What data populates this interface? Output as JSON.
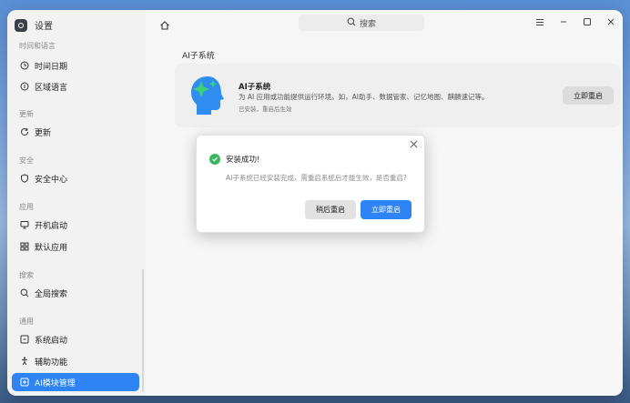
{
  "app": {
    "title": "设置"
  },
  "sidebar": {
    "groups": [
      {
        "label": "时间和语言",
        "items": [
          {
            "label": "时间日期",
            "icon": "clock-icon"
          },
          {
            "label": "区域语言",
            "icon": "region-icon"
          }
        ]
      },
      {
        "label": "更新",
        "items": [
          {
            "label": "更新",
            "icon": "refresh-icon"
          }
        ]
      },
      {
        "label": "安全",
        "items": [
          {
            "label": "安全中心",
            "icon": "shield-icon"
          }
        ]
      },
      {
        "label": "应用",
        "items": [
          {
            "label": "开机启动",
            "icon": "monitor-icon"
          },
          {
            "label": "默认应用",
            "icon": "grid-icon"
          }
        ]
      },
      {
        "label": "搜索",
        "items": [
          {
            "label": "全局搜索",
            "icon": "search-icon"
          }
        ]
      },
      {
        "label": "通用",
        "items": [
          {
            "label": "系统启动",
            "icon": "boot-icon"
          },
          {
            "label": "辅助功能",
            "icon": "accessibility-icon"
          },
          {
            "label": "AI模块管理",
            "icon": "ai-icon",
            "active": true
          }
        ]
      }
    ]
  },
  "header": {
    "search_placeholder": "搜索"
  },
  "main": {
    "section_title": "AI子系统",
    "card": {
      "name": "AI子系统",
      "description": "为 AI 应用或功能提供运行环境。如，AI助手、数据管家、记忆地图、麒麟速记等。",
      "status": "已安装，重启后生效",
      "button_label": "立即重启"
    }
  },
  "dialog": {
    "title": "安装成功!",
    "message": "AI子系统已经安装完成，需重启系统后才能生效，是否重启?",
    "later_label": "稍后重启",
    "now_label": "立即重启"
  },
  "colors": {
    "accent": "#2e84f5",
    "success": "#3bb55f"
  }
}
